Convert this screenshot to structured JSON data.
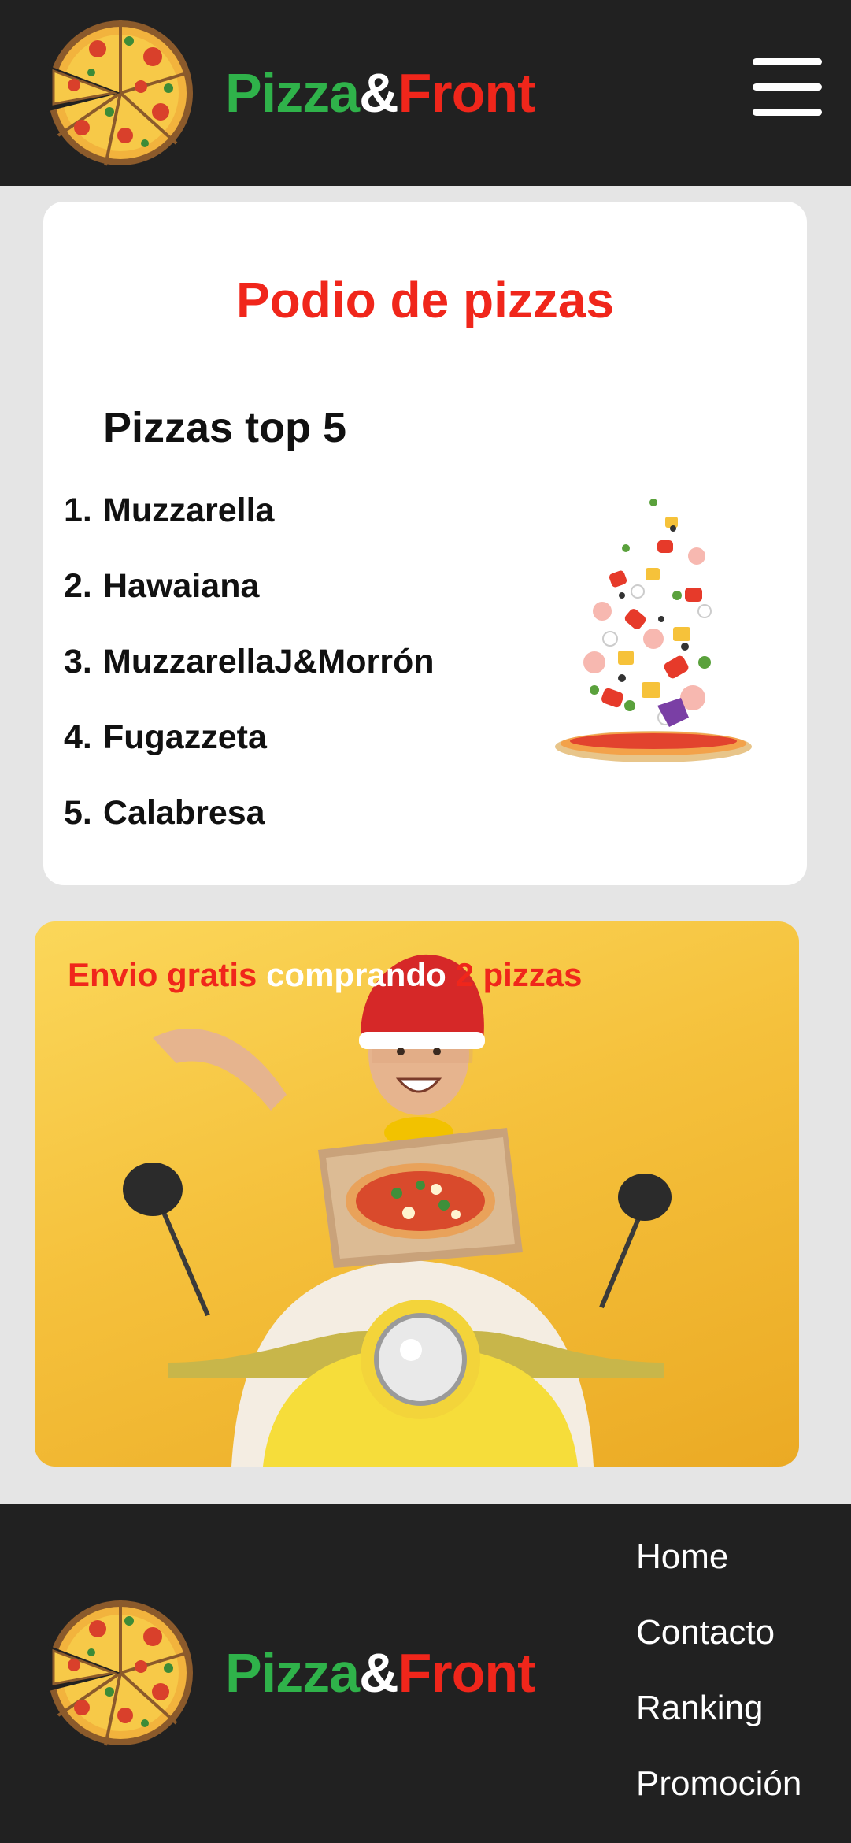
{
  "header": {
    "brand": {
      "part1": "Pizza",
      "amp": "&",
      "part2": "Front"
    },
    "logo_icon": "pizza-logo-icon",
    "menu_icon": "hamburger-menu-icon"
  },
  "podium": {
    "title": "Podio de pizzas",
    "subtitle": "Pizzas top 5",
    "items": [
      {
        "num": "1.",
        "name": "Muzzarella"
      },
      {
        "num": "2.",
        "name": "Hawaiana"
      },
      {
        "num": "3.",
        "name": "MuzzarellaJ&Morrón"
      },
      {
        "num": "4.",
        "name": "Fugazzeta"
      },
      {
        "num": "5.",
        "name": "Calabresa"
      }
    ],
    "image_icon": "flying-pizza-ingredients-image"
  },
  "promo": {
    "text_red1": "Envio gratis",
    "text_white": " comprando ",
    "text_red2": "2 pizzas",
    "image": "delivery-courier-on-scooter-image"
  },
  "footer": {
    "brand": {
      "part1": "Pizza",
      "amp": "&",
      "part2": "Front"
    },
    "nav": [
      "Home",
      "Contacto",
      "Ranking",
      "Promoción"
    ]
  },
  "colors": {
    "dark": "#212121",
    "brand_green": "#2fb24a",
    "brand_red": "#f0261b",
    "background": "#e5e5e5"
  }
}
